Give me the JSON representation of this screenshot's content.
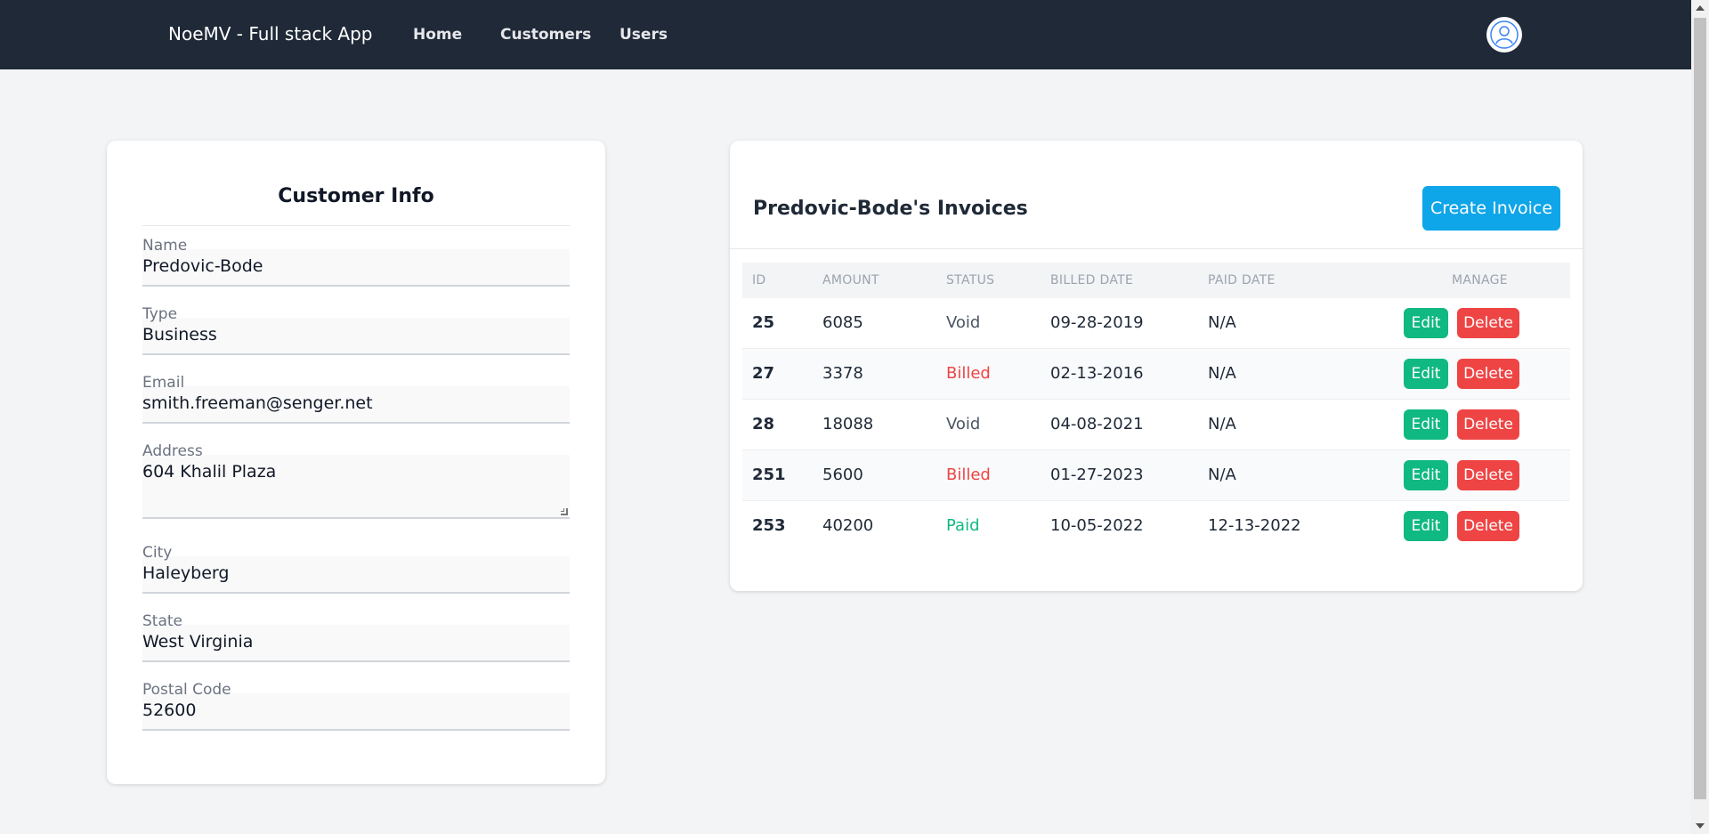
{
  "navbar": {
    "brand": "NoeMV - Full stack App",
    "links": [
      "Home",
      "Customers",
      "Users"
    ]
  },
  "customer_info": {
    "title": "Customer Info",
    "fields": {
      "name": {
        "label": "Name",
        "value": "Predovic-Bode"
      },
      "type": {
        "label": "Type",
        "value": "Business"
      },
      "email": {
        "label": "Email",
        "value": "smith.freeman@senger.net"
      },
      "address": {
        "label": "Address",
        "value": "604 Khalil Plaza"
      },
      "city": {
        "label": "City",
        "value": "Haleyberg"
      },
      "state": {
        "label": "State",
        "value": "West Virginia"
      },
      "postal_code": {
        "label": "Postal Code",
        "value": "52600"
      }
    }
  },
  "invoices": {
    "title": "Predovic-Bode's Invoices",
    "create_label": "Create Invoice",
    "headers": {
      "id": "ID",
      "amount": "AMOUNT",
      "status": "STATUS",
      "billed": "BILLED DATE",
      "paid": "PAID DATE",
      "manage": "MANAGE"
    },
    "edit_label": "Edit",
    "delete_label": "Delete",
    "status_colors": {
      "Void": "#4b5563",
      "Billed": "#ef4444",
      "Paid": "#10b981"
    },
    "rows": [
      {
        "id": "25",
        "amount": "6085",
        "status": "Void",
        "billed": "09-28-2019",
        "paid": "N/A"
      },
      {
        "id": "27",
        "amount": "3378",
        "status": "Billed",
        "billed": "02-13-2016",
        "paid": "N/A"
      },
      {
        "id": "28",
        "amount": "18088",
        "status": "Void",
        "billed": "04-08-2021",
        "paid": "N/A"
      },
      {
        "id": "251",
        "amount": "5600",
        "status": "Billed",
        "billed": "01-27-2023",
        "paid": "N/A"
      },
      {
        "id": "253",
        "amount": "40200",
        "status": "Paid",
        "billed": "10-05-2022",
        "paid": "12-13-2022"
      }
    ]
  }
}
